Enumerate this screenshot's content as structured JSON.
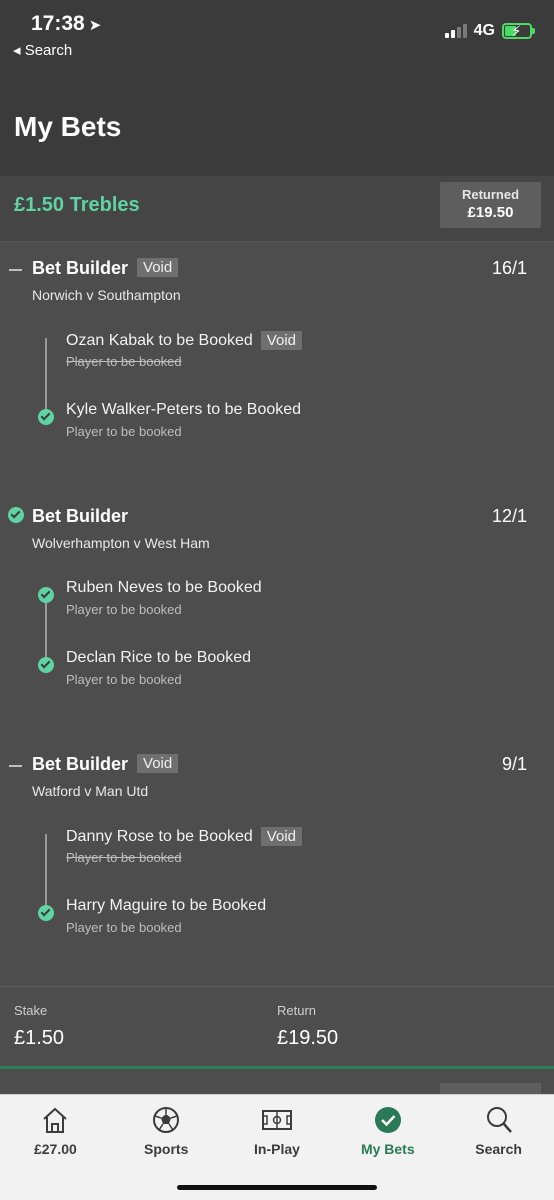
{
  "status_bar": {
    "time": "17:38",
    "back_label": "◂ Search",
    "network": "4G"
  },
  "header": {
    "title": "My Bets"
  },
  "bet": {
    "type": "£1.50 Trebles",
    "returned_label": "Returned",
    "returned_value": "£19.50"
  },
  "groups": [
    {
      "title": "Bet Builder",
      "badge": "Void",
      "odds": "16/1",
      "match": "Norwich v Southampton",
      "selections": [
        {
          "name": "Ozan Kabak to be Booked",
          "sub": "Player to be booked",
          "void": true,
          "badge": "Void"
        },
        {
          "name": "Kyle Walker-Peters to be Booked",
          "sub": "Player to be booked",
          "won": true
        }
      ]
    },
    {
      "title": "Bet Builder",
      "odds": "12/1",
      "match": "Wolverhampton v West Ham",
      "selections": [
        {
          "name": "Ruben Neves to be Booked",
          "sub": "Player to be booked",
          "won": true
        },
        {
          "name": "Declan Rice to be Booked",
          "sub": "Player to be booked",
          "won": true
        }
      ]
    },
    {
      "title": "Bet Builder",
      "badge": "Void",
      "odds": "9/1",
      "match": "Watford v Man Utd",
      "selections": [
        {
          "name": "Danny Rose to be Booked",
          "sub": "Player to be booked",
          "void": true,
          "badge": "Void"
        },
        {
          "name": "Harry Maguire to be Booked",
          "sub": "Player to be booked",
          "won": true
        }
      ]
    }
  ],
  "summary": {
    "stake_label": "Stake",
    "stake_value": "£1.50",
    "return_label": "Return",
    "return_value": "£19.50"
  },
  "tabbar": [
    {
      "label": "£27.00",
      "icon": "home-icon"
    },
    {
      "label": "Sports",
      "icon": "football-icon"
    },
    {
      "label": "In-Play",
      "icon": "pitch-icon"
    },
    {
      "label": "My Bets",
      "icon": "check-circle-icon",
      "active": true
    },
    {
      "label": "Search",
      "icon": "search-icon"
    }
  ],
  "colors": {
    "accent": "#5fd3a4",
    "tab_active": "#2b7a56",
    "background": "#4d4d4d"
  }
}
